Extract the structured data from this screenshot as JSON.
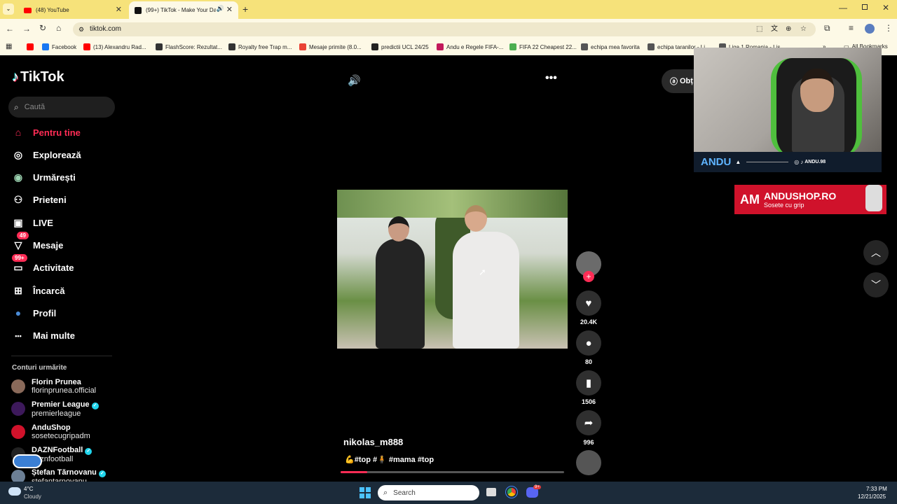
{
  "browser": {
    "tabs": [
      {
        "title": "(48) YouTube",
        "active": false
      },
      {
        "title": "(99+) TikTok - Make Your Da",
        "active": true
      }
    ],
    "url": "tiktok.com",
    "bookmarks": [
      {
        "label": "",
        "color": "#ff0000"
      },
      {
        "label": "Facebook",
        "color": "#1877f2"
      },
      {
        "label": "(13) Alexandru Rad...",
        "color": "#ff0000"
      },
      {
        "label": "FlashScore: Rezultat...",
        "color": "#333"
      },
      {
        "label": "Royalty free Trap m...",
        "color": "#333"
      },
      {
        "label": "Mesaje primite (8.0...",
        "color": "#ea4335"
      },
      {
        "label": "predictii UCL 24/25",
        "color": "#222"
      },
      {
        "label": "Andu e Regele FIFA-...",
        "color": "#c2185b"
      },
      {
        "label": "FIFA 22 Cheapest 22...",
        "color": "#4caf50"
      },
      {
        "label": "echipa mea favorita",
        "color": "#555"
      },
      {
        "label": "echipa taranilor - Li",
        "color": "#555"
      },
      {
        "label": "Liga 1 Romania - Lis",
        "color": "#555"
      }
    ],
    "all_bookmarks": "All Bookmarks"
  },
  "sidebar": {
    "logo": "TikTok",
    "search_placeholder": "Caută",
    "nav": [
      {
        "label": "Pentru tine",
        "icon": "home-icon",
        "active": true
      },
      {
        "label": "Explorează",
        "icon": "compass-icon"
      },
      {
        "label": "Urmărești",
        "icon": "following-icon"
      },
      {
        "label": "Prieteni",
        "icon": "friends-icon"
      },
      {
        "label": "LIVE",
        "icon": "live-icon"
      },
      {
        "label": "Mesaje",
        "icon": "messages-icon",
        "badge": "49"
      },
      {
        "label": "Activitate",
        "icon": "activity-icon",
        "badge": "99+"
      },
      {
        "label": "Încarcă",
        "icon": "upload-icon"
      },
      {
        "label": "Profil",
        "icon": "profile-icon"
      },
      {
        "label": "Mai multe",
        "icon": "more-icon"
      }
    ],
    "following_title": "Conturi urmărite",
    "accounts": [
      {
        "name": "Florin Prunea",
        "handle": "florinprunea.official",
        "verified": false
      },
      {
        "name": "Premier League",
        "handle": "premierleague",
        "verified": true
      },
      {
        "name": "AnduShop",
        "handle": "sosetecugripadm",
        "verified": false
      },
      {
        "name": "DAZNFootball",
        "handle": "daznfootball",
        "verified": true
      },
      {
        "name": "Ștefan Tărnovanu",
        "handle": "stefantarnovanu",
        "verified": true
      }
    ]
  },
  "player": {
    "username": "nikolas_m888",
    "caption": "💪#top #🧍 #mama #top",
    "get_app_label": "Obț",
    "progress": 0.12
  },
  "actions": {
    "likes": "20.4K",
    "comments": "80",
    "saves": "1506",
    "shares": "996"
  },
  "overlay": {
    "streamer": "ANDU",
    "social": "ANDU.98",
    "shop_title": "ANDUSHOP.RO",
    "shop_subtitle": "Sosete cu grip"
  },
  "taskbar": {
    "temp": "4°C",
    "weather": "Cloudy",
    "search_placeholder": "Search",
    "time": "7:33 PM",
    "date": "12/21/2025",
    "discord_badge": "9+"
  }
}
